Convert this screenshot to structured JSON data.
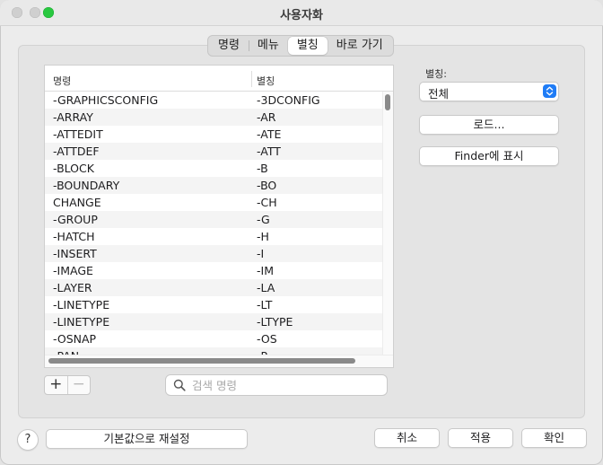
{
  "window": {
    "title": "사용자화"
  },
  "tabs": [
    {
      "label": "명령",
      "active": false
    },
    {
      "label": "메뉴",
      "active": false
    },
    {
      "label": "별칭",
      "active": true
    },
    {
      "label": "바로 가기",
      "active": false
    }
  ],
  "table": {
    "headers": {
      "command": "명령",
      "alias": "별칭"
    },
    "rows": [
      {
        "command": "-GRAPHICSCONFIG",
        "alias": "-3DCONFIG"
      },
      {
        "command": "-ARRAY",
        "alias": "-AR"
      },
      {
        "command": "-ATTEDIT",
        "alias": "-ATE"
      },
      {
        "command": "-ATTDEF",
        "alias": "-ATT"
      },
      {
        "command": "-BLOCK",
        "alias": "-B"
      },
      {
        "command": "-BOUNDARY",
        "alias": "-BO"
      },
      {
        "command": "CHANGE",
        "alias": "-CH"
      },
      {
        "command": "-GROUP",
        "alias": "-G"
      },
      {
        "command": "-HATCH",
        "alias": "-H"
      },
      {
        "command": "-INSERT",
        "alias": "-I"
      },
      {
        "command": "-IMAGE",
        "alias": "-IM"
      },
      {
        "command": "-LAYER",
        "alias": "-LA"
      },
      {
        "command": "-LINETYPE",
        "alias": "-LT"
      },
      {
        "command": "-LINETYPE",
        "alias": "-LTYPE"
      },
      {
        "command": "-OSNAP",
        "alias": "-OS"
      },
      {
        "command": "-PAN",
        "alias": "-P"
      }
    ]
  },
  "table_controls": {
    "add": "+",
    "remove": "−"
  },
  "search": {
    "placeholder": "검색 명령",
    "value": ""
  },
  "sidebar": {
    "alias_label": "별칭:",
    "alias_select_value": "전체",
    "load_button": "로드...",
    "finder_button": "Finder에 표시"
  },
  "footer": {
    "help": "?",
    "reset_button": "기본값으로 재설정",
    "cancel_button": "취소",
    "apply_button": "적용",
    "ok_button": "확인"
  },
  "colors": {
    "accent": "#1f7cf6",
    "zoom_button": "#29c840"
  },
  "icons": {
    "search": "search-icon",
    "select": "chevron-up-down-icon",
    "help": "help-icon"
  }
}
